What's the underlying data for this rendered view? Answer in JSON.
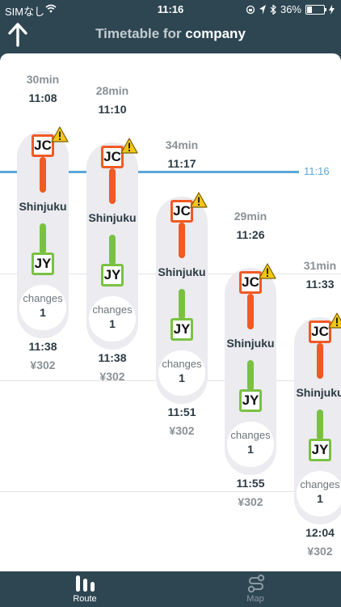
{
  "status": {
    "carrier": "SIMなし",
    "time": "11:16",
    "battery": "36%",
    "battery_level": 0.36
  },
  "nav": {
    "title_prefix": "Timetable for",
    "title_dest": "company"
  },
  "now_label": "11:16",
  "routes": [
    {
      "duration": "30min",
      "depart": "11:08",
      "line1": "JC",
      "station": "Shinjuku",
      "line2": "JY",
      "changes_label": "changes",
      "changes": "1",
      "arrive": "11:38",
      "fare": "¥302"
    },
    {
      "duration": "28min",
      "depart": "11:10",
      "line1": "JC",
      "station": "Shinjuku",
      "line2": "JY",
      "changes_label": "changes",
      "changes": "1",
      "arrive": "11:38",
      "fare": "¥302"
    },
    {
      "duration": "34min",
      "depart": "11:17",
      "line1": "JC",
      "station": "Shinjuku",
      "line2": "JY",
      "changes_label": "changes",
      "changes": "1",
      "arrive": "11:51",
      "fare": "¥302"
    },
    {
      "duration": "29min",
      "depart": "11:26",
      "line1": "JC",
      "station": "Shinjuku",
      "line2": "JY",
      "changes_label": "changes",
      "changes": "1",
      "arrive": "11:55",
      "fare": "¥302"
    },
    {
      "duration": "31min",
      "depart": "11:33",
      "line1": "JC",
      "station": "Shinjuku",
      "line2": "JY",
      "changes_label": "changes",
      "changes": "1",
      "arrive": "12:04",
      "fare": "¥302"
    }
  ],
  "tabs": {
    "route": "Route",
    "map": "Map"
  },
  "colors": {
    "jc": "#f05a24",
    "jy": "#7ac142",
    "now_line": "#5aa7d8",
    "header": "#2e4652"
  }
}
